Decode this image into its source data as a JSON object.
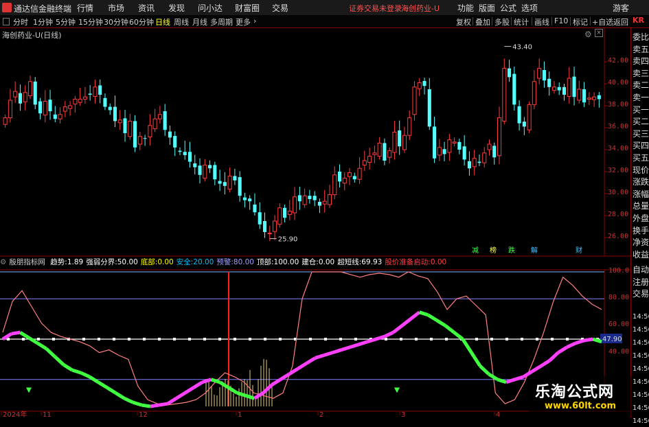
{
  "app": {
    "name": "通达信金融终端",
    "menu": [
      "行情",
      "市场",
      "资讯",
      "发现",
      "问小达",
      "财富圈",
      "交易"
    ],
    "warning": "证券交易未登录",
    "stock_short": "海创药业-U",
    "right_menu": [
      "功能",
      "版面",
      "公式",
      "选项"
    ],
    "guest": "游客"
  },
  "periods": {
    "items": [
      "分时",
      "1分钟",
      "5分钟",
      "15分钟",
      "30分钟",
      "60分钟",
      "日线",
      "周线",
      "月线",
      "多周期",
      "更多"
    ],
    "active": "日线"
  },
  "toolbar": {
    "items": [
      "复权",
      "叠加",
      "多股",
      "统计",
      "画线",
      "F10",
      "标记",
      "+自选",
      "返回"
    ]
  },
  "stock_title": "海创药业-U(日线)",
  "right_panel": {
    "top_code": "KR",
    "items": [
      "委比",
      "卖五",
      "卖四",
      "卖三",
      "卖二",
      "卖一",
      "买一",
      "买二",
      "买三",
      "买四",
      "买五",
      "现价",
      "涨跌",
      "涨幅",
      "总量",
      "外盘",
      "换手",
      "净资",
      "收益"
    ],
    "lower_items": [
      "自动",
      "注册",
      "交易"
    ],
    "lower_times": [
      "14:56",
      "14:56",
      "14:56",
      "14:56",
      "14:56",
      "14:56",
      "14:56",
      "14:56",
      "14:56"
    ]
  },
  "chart_data": [
    {
      "type": "candlestick",
      "title": "海创药业-U(日线)",
      "ylim": [
        25,
        44
      ],
      "y_ticks": [
        26.0,
        28.0,
        30.0,
        32.0,
        34.0,
        36.0,
        38.0,
        40.0,
        42.0
      ],
      "annotations": [
        {
          "label": "43.40",
          "kind": "high"
        },
        {
          "label": "25.90",
          "kind": "low"
        }
      ],
      "event_markers": [
        "减",
        "榜",
        "跌",
        "解",
        "财"
      ],
      "closes": [
        36.9,
        38.5,
        39.3,
        38.2,
        39.2,
        40.2,
        38.1,
        37.3,
        38.4,
        37.5,
        36.8,
        37.2,
        37.9,
        38.0,
        38.6,
        38.6,
        38.8,
        39.0,
        39.7,
        39.0,
        37.9,
        37.6,
        36.6,
        36.7,
        35.5,
        36.6,
        34.2,
        35.2,
        35.0,
        36.2,
        36.8,
        37.2,
        35.8,
        35.1,
        34.2,
        33.8,
        33.5,
        32.9,
        32.4,
        31.7,
        32.6,
        32.3,
        31.3,
        30.9,
        30.7,
        31.6,
        31.2,
        29.8,
        29.4,
        29.3,
        28.3,
        27.2,
        26.5,
        26.4,
        27.5,
        28.7,
        27.8,
        28.4,
        29.7,
        29.3,
        29.8,
        29.5,
        29.4,
        28.9,
        29.3,
        29.9,
        31.7,
        31.1,
        31.4,
        31.9,
        31.3,
        32.3,
        33.0,
        33.4,
        33.7,
        34.6,
        33.0,
        33.9,
        35.6,
        34.3,
        35.3,
        36.9,
        39.7,
        40.1,
        39.8,
        36.1,
        33.2,
        34.2,
        33.6,
        34.9,
        34.7,
        34.0,
        33.1,
        32.3,
        33.2,
        32.8,
        33.7,
        34.5,
        33.3,
        36.9,
        41.4,
        40.6,
        38.1,
        36.4,
        36.1,
        38.1,
        40.2,
        41.4,
        40.3,
        39.7,
        39.7,
        39.4,
        39.0,
        40.5,
        38.8,
        39.5,
        38.3,
        38.7,
        38.8,
        38.6
      ]
    },
    {
      "type": "line",
      "title": "殷朋指标网",
      "ylim": [
        0,
        100
      ],
      "y_ticks": [
        40.0,
        60.0,
        80.0,
        100.0
      ],
      "current_value_tag": "47.90",
      "fields": [
        {
          "label": "趋势:",
          "value": "1.89",
          "color": "#ffffff"
        },
        {
          "label": "强弱分界:",
          "value": "50.00",
          "color": "#ffffff"
        },
        {
          "label": "底部:",
          "value": "0.00",
          "color": "#ffff00"
        },
        {
          "label": "安全:",
          "value": "20.00",
          "color": "#00c0ff"
        },
        {
          "label": "预警:",
          "value": "80.00",
          "color": "#a0a0ff"
        },
        {
          "label": "顶部:",
          "value": "100.00",
          "color": "#ffffff"
        },
        {
          "label": "建仓:",
          "value": "0.00",
          "color": "#ffffff"
        },
        {
          "label": "超短线:",
          "value": "69.93",
          "color": "#ffffff"
        },
        {
          "label": "股价准备启动:",
          "value": "0.00",
          "color": "#ff4040"
        }
      ],
      "reference_lines": [
        100,
        80,
        50,
        20
      ],
      "x_tick_labels": [
        "2024年",
        "11",
        "12",
        "1",
        "2",
        "3",
        "4"
      ],
      "series": [
        {
          "name": "超短线",
          "color": "#ff8080",
          "values": [
            55,
            78,
            86,
            74,
            62,
            55,
            52,
            50,
            48,
            45,
            40,
            42,
            38,
            35,
            15,
            5,
            2,
            1,
            2,
            3,
            5,
            10,
            18,
            25,
            22,
            18,
            10,
            8,
            6,
            10,
            30,
            80,
            100,
            100,
            100,
            100,
            98,
            96,
            98,
            99,
            98,
            96,
            100,
            97,
            95,
            85,
            72,
            80,
            82,
            75,
            68,
            10,
            2,
            5,
            18,
            35,
            55,
            78,
            96,
            90,
            82,
            76,
            72
          ]
        },
        {
          "name": "趋势",
          "color": "#ff00ff",
          "values": [
            50,
            54,
            55,
            51,
            47,
            43,
            37,
            31,
            27,
            25,
            22,
            18,
            14,
            10,
            6,
            3,
            1,
            0,
            1,
            2,
            6,
            10,
            14,
            18,
            20,
            18,
            14,
            10,
            8,
            6,
            10,
            16,
            20,
            24,
            28,
            32,
            36,
            38,
            40,
            42,
            44,
            46,
            48,
            50,
            52,
            55,
            60,
            65,
            70,
            68,
            64,
            60,
            55,
            50,
            40,
            30,
            24,
            20,
            18,
            20,
            22,
            26,
            30,
            34,
            40,
            44,
            47,
            49,
            50,
            48
          ]
        }
      ]
    }
  ],
  "watermark": {
    "line1": "乐淘公式网",
    "line2": "www.60lt.com"
  }
}
